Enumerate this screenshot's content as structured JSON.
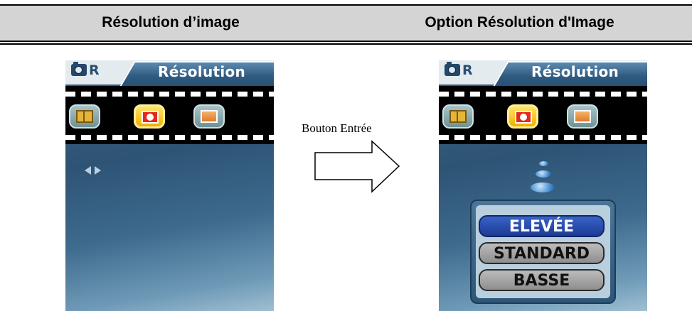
{
  "table": {
    "left_header": "Résolution d’image",
    "right_header": "Option Résolution d'Image"
  },
  "screen": {
    "mode_letter": "R",
    "tab_title": "Résolution",
    "icons": [
      "resolution-icon",
      "quality-icon",
      "sharpness-icon"
    ],
    "selected_icon": 1
  },
  "transition_label": "Bouton Entrée",
  "options": {
    "items": [
      "ELEVÉE",
      "STANDARD",
      "BASSE"
    ],
    "selected_index": 0
  },
  "colors": {
    "header_bg": "#d4d4d4",
    "screen_bg": "#2e5475",
    "selected_option": "#1b3a94",
    "selected_icon": "#f2b000"
  }
}
